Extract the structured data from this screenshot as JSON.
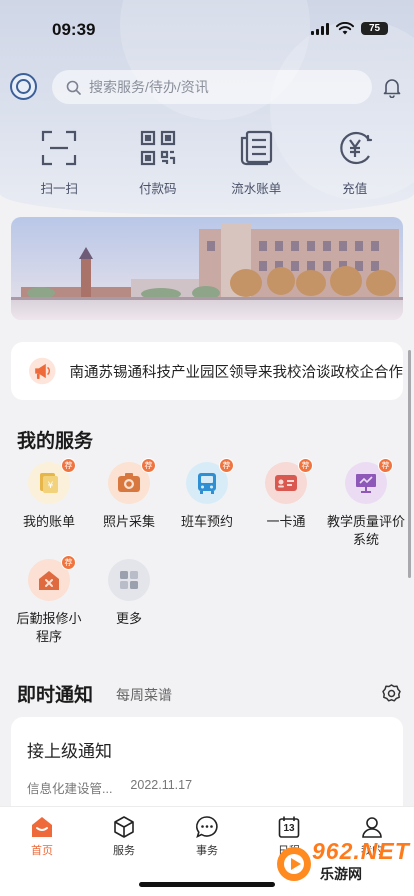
{
  "status_bar": {
    "time": "09:39",
    "battery": "75"
  },
  "search": {
    "placeholder": "搜索服务/待办/资讯"
  },
  "quick_actions": [
    {
      "label": "扫一扫",
      "icon": "scan-icon"
    },
    {
      "label": "付款码",
      "icon": "qr-code-icon"
    },
    {
      "label": "流水账单",
      "icon": "ledger-icon"
    },
    {
      "label": "充值",
      "icon": "yuan-recharge-icon"
    }
  ],
  "news": {
    "text": "南通苏锡通科技产业园区领导来我校洽谈政校企合作"
  },
  "services": {
    "title": "我的服务",
    "badge": "荐",
    "items": [
      {
        "label": "我的账单",
        "icon": "bill-icon",
        "color": "#f1d58a",
        "bg": "#fbf1da"
      },
      {
        "label": "照片采集",
        "icon": "camera-icon",
        "color": "#d9783e",
        "bg": "#fbe2d2"
      },
      {
        "label": "班车预约",
        "icon": "bus-icon",
        "color": "#2f8fd3",
        "bg": "#d8ecf8"
      },
      {
        "label": "一卡通",
        "icon": "card-icon",
        "color": "#d9584f",
        "bg": "#f7d9d5"
      },
      {
        "label": "教学质量评价系统",
        "icon": "presentation-icon",
        "color": "#8e58b8",
        "bg": "#ebdcf4"
      },
      {
        "label": "后勤报修小程序",
        "icon": "house-repair-icon",
        "color": "#e06a3f",
        "bg": "#fbe0d3"
      },
      {
        "label": "更多",
        "icon": "more-grid-icon",
        "color": "#9aa0ad",
        "bg": "#e3e5ea"
      }
    ]
  },
  "notice": {
    "title": "即时通知",
    "tab": "每周菜谱",
    "card_title": "接上级通知",
    "source": "信息化建设管...",
    "date": "2022.11.17"
  },
  "tab_bar": [
    {
      "label": "首页",
      "active": true
    },
    {
      "label": "服务",
      "active": false
    },
    {
      "label": "事务",
      "active": false
    },
    {
      "label": "日程",
      "active": false,
      "day": "13"
    },
    {
      "label": "我的",
      "active": false
    }
  ],
  "watermark": {
    "text": "962.NET",
    "sub": "乐游网"
  },
  "colors": {
    "accent": "#ef6a3a",
    "header_bg": "#cfd6e6",
    "page_bg": "#f2f2f4"
  }
}
